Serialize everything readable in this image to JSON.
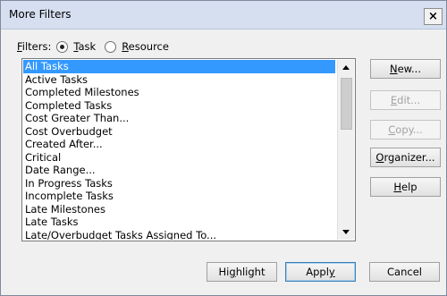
{
  "window": {
    "title": "More Filters",
    "close_glyph": "×"
  },
  "filters": {
    "label_prefix": "F",
    "label_rest": "ilters:",
    "task": {
      "prefix": "",
      "mnemonic": "T",
      "rest": "ask",
      "selected": true
    },
    "resource": {
      "prefix": "",
      "mnemonic": "R",
      "rest": "esource",
      "selected": false
    }
  },
  "list": {
    "selected_index": 0,
    "items": [
      "All Tasks",
      "Active Tasks",
      "Completed Milestones",
      "Completed Tasks",
      "Cost Greater Than...",
      "Cost Overbudget",
      "Created After...",
      "Critical",
      "Date Range...",
      "In Progress Tasks",
      "Incomplete Tasks",
      "Late Milestones",
      "Late Tasks",
      "Late/Overbudget Tasks Assigned To..."
    ]
  },
  "buttons": {
    "new": {
      "prefix": "",
      "mnemonic": "N",
      "rest": "ew..."
    },
    "edit": {
      "prefix": "",
      "mnemonic": "E",
      "rest": "dit..."
    },
    "copy": {
      "prefix": "",
      "mnemonic": "C",
      "rest": "opy..."
    },
    "organizer": {
      "prefix": "",
      "mnemonic": "O",
      "rest": "rganizer..."
    },
    "help": {
      "prefix": "",
      "mnemonic": "H",
      "rest": "elp"
    },
    "highlight": {
      "prefix": "Hi",
      "mnemonic": "g",
      "rest": "hlight"
    },
    "apply": {
      "prefix": "Appl",
      "mnemonic": "y",
      "rest": ""
    },
    "cancel": {
      "prefix": "Cancel",
      "mnemonic": "",
      "rest": ""
    }
  }
}
